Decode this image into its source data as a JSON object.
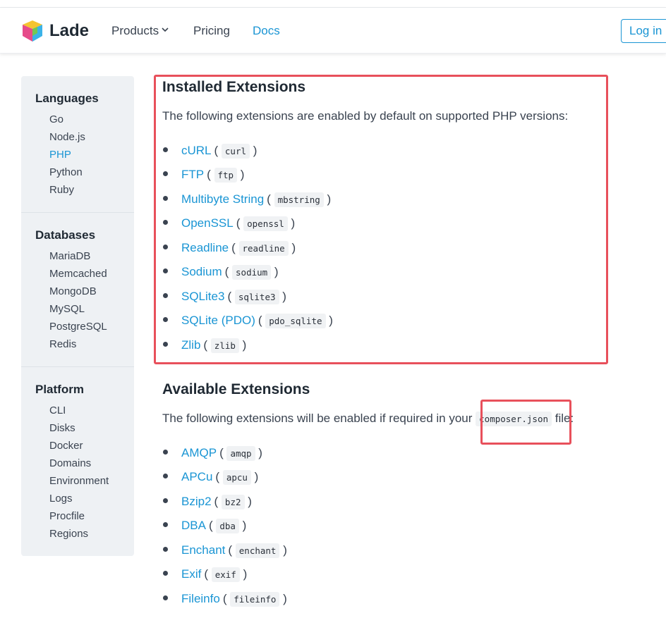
{
  "nav": {
    "brand": "Lade",
    "products": "Products",
    "pricing": "Pricing",
    "docs": "Docs",
    "login": "Log in"
  },
  "sidebar": {
    "sections": [
      {
        "title": "Languages",
        "items": [
          "Go",
          "Node.js",
          "PHP",
          "Python",
          "Ruby"
        ],
        "active": "PHP"
      },
      {
        "title": "Databases",
        "items": [
          "MariaDB",
          "Memcached",
          "MongoDB",
          "MySQL",
          "PostgreSQL",
          "Redis"
        ]
      },
      {
        "title": "Platform",
        "items": [
          "CLI",
          "Disks",
          "Docker",
          "Domains",
          "Environment",
          "Logs",
          "Procfile",
          "Regions"
        ]
      }
    ]
  },
  "installed": {
    "heading": "Installed Extensions",
    "description": "The following extensions are enabled by default on supported PHP versions:",
    "extensions": [
      {
        "name": "cURL",
        "code": "curl"
      },
      {
        "name": "FTP",
        "code": "ftp"
      },
      {
        "name": "Multibyte String",
        "code": "mbstring"
      },
      {
        "name": "OpenSSL",
        "code": "openssl"
      },
      {
        "name": "Readline",
        "code": "readline"
      },
      {
        "name": "Sodium",
        "code": "sodium"
      },
      {
        "name": "SQLite3",
        "code": "sqlite3"
      },
      {
        "name": "SQLite (PDO)",
        "code": "pdo_sqlite"
      },
      {
        "name": "Zlib",
        "code": "zlib"
      }
    ]
  },
  "available": {
    "heading": "Available Extensions",
    "description_before": "The following extensions will be enabled if required in your",
    "description_code": "composer.json",
    "description_after": "file:",
    "extensions": [
      {
        "name": "AMQP",
        "code": "amqp"
      },
      {
        "name": "APCu",
        "code": "apcu"
      },
      {
        "name": "Bzip2",
        "code": "bz2"
      },
      {
        "name": "DBA",
        "code": "dba"
      },
      {
        "name": "Enchant",
        "code": "enchant"
      },
      {
        "name": "Exif",
        "code": "exif"
      },
      {
        "name": "Fileinfo",
        "code": "fileinfo"
      }
    ]
  },
  "colors": {
    "link": "#1a95d4",
    "highlight": "#e8505b",
    "sidebar_bg": "#eef1f4"
  }
}
